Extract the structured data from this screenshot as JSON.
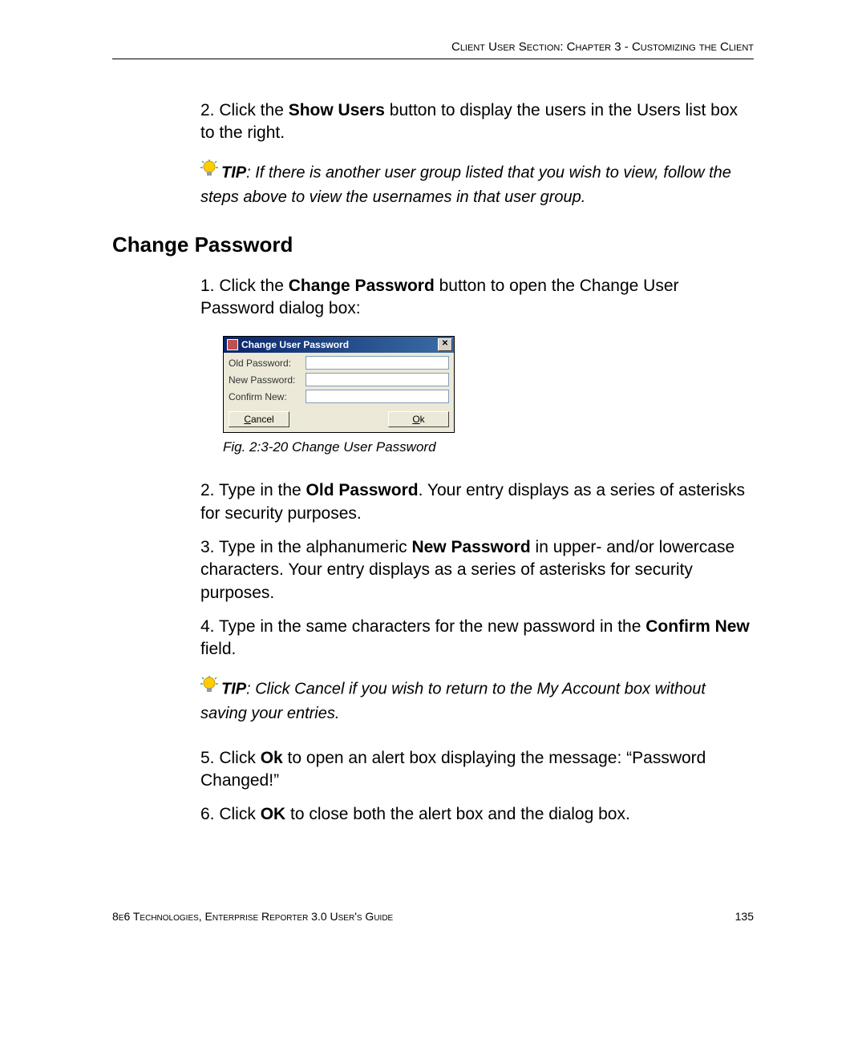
{
  "header": "Client User Section: Chapter 3 - Customizing the Client",
  "step2_pre": "2.  Click the ",
  "step2_bold": "Show Users",
  "step2_post": " button to display the users in the Users list box to the right.",
  "tip_label": "TIP",
  "tip1_text": ": If there is another user group listed that you wish to view, follow the steps above to view the usernames in that user group.",
  "section_heading": "Change  Password",
  "cp1_pre": "1.  Click the ",
  "cp1_bold": "Change Password",
  "cp1_post": " button to open the Change User Password dialog box:",
  "dialog": {
    "title": "Change User Password",
    "old_label": "Old Password:",
    "new_label": "New Password:",
    "confirm_label": "Confirm New:",
    "cancel_u": "C",
    "cancel_rest": "ancel",
    "ok_u": "O",
    "ok_rest": "k"
  },
  "caption": "Fig. 2:3-20  Change User Password",
  "cp2_pre": "2.  Type in the ",
  "cp2_bold": "Old Password",
  "cp2_post": ". Your entry displays as a series of asterisks for security purposes.",
  "cp3_pre": "3.  Type in the alphanumeric ",
  "cp3_bold": "New Password",
  "cp3_post": " in upper- and/or lowercase characters. Your entry displays as a series of asterisks for security purposes.",
  "cp4_pre": "4.  Type in the same characters for the new password in the ",
  "cp4_bold": "Confirm New",
  "cp4_post": " field.",
  "tip2_text": ": Click Cancel if you wish to return to the My Account box without saving your entries.",
  "cp5_pre": "5.  Click ",
  "cp5_bold": "Ok",
  "cp5_post": " to open an alert box displaying the message: “Password Changed!”",
  "cp6_pre": "6.  Click ",
  "cp6_bold": "OK",
  "cp6_post": " to close both the alert box and the dialog box.",
  "footer_left": "8e6 Technologies, Enterprise Reporter 3.0 User's Guide",
  "footer_right": "135"
}
